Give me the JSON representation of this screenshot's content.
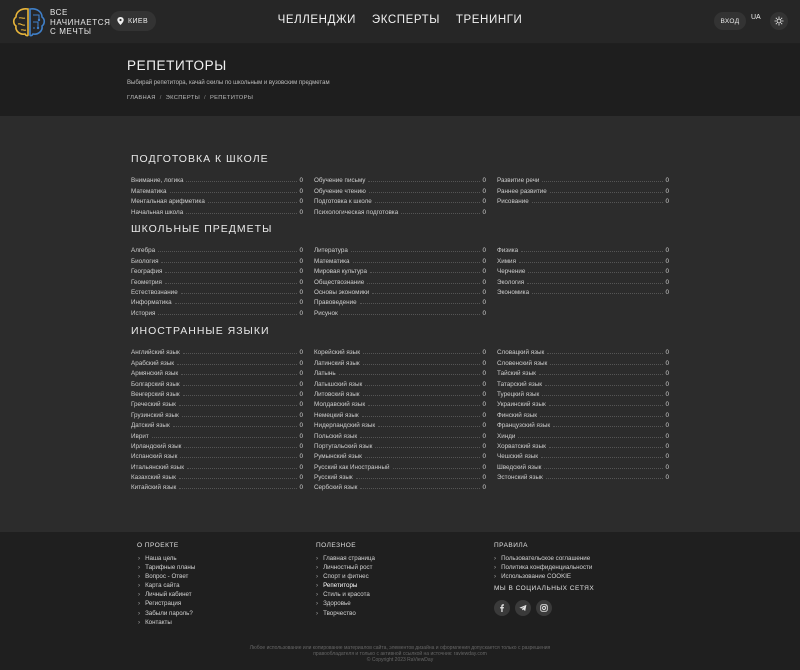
{
  "header": {
    "logo_lines": [
      "ВСЕ",
      "НАЧИНАЕТСЯ",
      "С МЕЧТЫ"
    ],
    "city": "КИЕВ",
    "nav": [
      "ЧЕЛЛЕНДЖИ",
      "ЭКСПЕРТЫ",
      "ТРЕНИНГИ"
    ],
    "login": "ВХОД",
    "lang": "UA"
  },
  "hero": {
    "title": "РЕПЕТИТОРЫ",
    "subtitle": "Выбирай репетитора, качай скилы по школьным и вузовским предметам",
    "breadcrumbs": [
      "ГЛАВНАЯ",
      "ЭКСПЕРТЫ",
      "РЕПЕТИТОРЫ"
    ]
  },
  "sections": [
    {
      "title": "ПОДГОТОВКА К ШКОЛЕ",
      "columns": [
        [
          [
            "Внимание, логика",
            "0"
          ],
          [
            "Математика",
            "0"
          ],
          [
            "Ментальная арифметика",
            "0"
          ],
          [
            "Начальная школа",
            "0"
          ]
        ],
        [
          [
            "Обучение письму",
            "0"
          ],
          [
            "Обучение чтению",
            "0"
          ],
          [
            "Подготовка к школе",
            "0"
          ],
          [
            "Психологическая подготовка",
            "0"
          ]
        ],
        [
          [
            "Развитие речи",
            "0"
          ],
          [
            "Раннее развитие",
            "0"
          ],
          [
            "Рисование",
            "0"
          ]
        ]
      ]
    },
    {
      "title": "ШКОЛЬНЫЕ ПРЕДМЕТЫ",
      "columns": [
        [
          [
            "Алгебра",
            "0"
          ],
          [
            "Биология",
            "0"
          ],
          [
            "География",
            "0"
          ],
          [
            "Геометрия",
            "0"
          ],
          [
            "Естествознание",
            "0"
          ],
          [
            "Информатика",
            "0"
          ],
          [
            "История",
            "0"
          ]
        ],
        [
          [
            "Литература",
            "0"
          ],
          [
            "Математика",
            "0"
          ],
          [
            "Мировая культура",
            "0"
          ],
          [
            "Обществознание",
            "0"
          ],
          [
            "Основы экономики",
            "0"
          ],
          [
            "Правоведение",
            "0"
          ],
          [
            "Рисунок",
            "0"
          ]
        ],
        [
          [
            "Физика",
            "0"
          ],
          [
            "Химия",
            "0"
          ],
          [
            "Черчение",
            "0"
          ],
          [
            "Экология",
            "0"
          ],
          [
            "Экономика",
            "0"
          ]
        ]
      ]
    },
    {
      "title": "ИНОСТРАННЫЕ ЯЗЫКИ",
      "columns": [
        [
          [
            "Английский язык",
            "0"
          ],
          [
            "Арабский язык",
            "0"
          ],
          [
            "Армянский язык",
            "0"
          ],
          [
            "Болгарский язык",
            "0"
          ],
          [
            "Венгерский язык",
            "0"
          ],
          [
            "Греческий язык",
            "0"
          ],
          [
            "Грузинский язык",
            "0"
          ],
          [
            "Датский язык",
            "0"
          ],
          [
            "Иврит",
            "0"
          ],
          [
            "Ирландский язык",
            "0"
          ],
          [
            "Испанский язык",
            "0"
          ],
          [
            "Итальянский язык",
            "0"
          ],
          [
            "Казахский язык",
            "0"
          ],
          [
            "Китайский язык",
            "0"
          ]
        ],
        [
          [
            "Корейский язык",
            "0"
          ],
          [
            "Латинский язык",
            "0"
          ],
          [
            "Латынь",
            "0"
          ],
          [
            "Латышский язык",
            "0"
          ],
          [
            "Литовский язык",
            "0"
          ],
          [
            "Молдавский язык",
            "0"
          ],
          [
            "Немецкий язык",
            "0"
          ],
          [
            "Нидерландский язык",
            "0"
          ],
          [
            "Польский язык",
            "0"
          ],
          [
            "Португальский язык",
            "0"
          ],
          [
            "Румынский язык",
            "0"
          ],
          [
            "Русский как Иностранный",
            "0"
          ],
          [
            "Русский язык",
            "0"
          ],
          [
            "Сербский язык",
            "0"
          ]
        ],
        [
          [
            "Словацкий язык",
            "0"
          ],
          [
            "Словенский язык",
            "0"
          ],
          [
            "Тайский язык",
            "0"
          ],
          [
            "Татарский язык",
            "0"
          ],
          [
            "Турецкий язык",
            "0"
          ],
          [
            "Украинский язык",
            "0"
          ],
          [
            "Финский язык",
            "0"
          ],
          [
            "Французский язык",
            "0"
          ],
          [
            "Хинди",
            "0"
          ],
          [
            "Хорватский язык",
            "0"
          ],
          [
            "Чешский язык",
            "0"
          ],
          [
            "Шведский язык",
            "0"
          ],
          [
            "Эстонский язык",
            "0"
          ]
        ]
      ]
    }
  ],
  "footer": {
    "about_title": "О ПРОЕКТЕ",
    "about_links": [
      "Наша цель",
      "Тарифные планы",
      "Вопрос - Ответ",
      "Карта сайта",
      "Личный кабинет",
      "Регистрация",
      "Забыли пароль?",
      "Контакты"
    ],
    "useful_title": "ПОЛЕЗНОЕ",
    "useful_links": [
      "Главная страница",
      "Личностный рост",
      "Спорт и фитнес",
      "Репетиторы",
      "Стиль и красота",
      "Здоровье",
      "Творчество"
    ],
    "rules_title": "ПРАВИЛА",
    "rules_links": [
      "Пользовательское соглашение",
      "Политика конфиденциальности",
      "Использование COOKIE"
    ],
    "social_title": "МЫ В СОЦИАЛЬНЫХ СЕТЯХ",
    "socials": [
      "facebook-icon",
      "telegram-icon",
      "instagram-icon"
    ],
    "copyright_1": "Любое использование или копирование материалов сайта, элементов дизайна и оформления допускается только с разрешения",
    "copyright_2": "правообладателя и только с активной ссылкой на источник: raviewday.com",
    "copyright_3": "© Copyright 2023 RaViewDay"
  }
}
